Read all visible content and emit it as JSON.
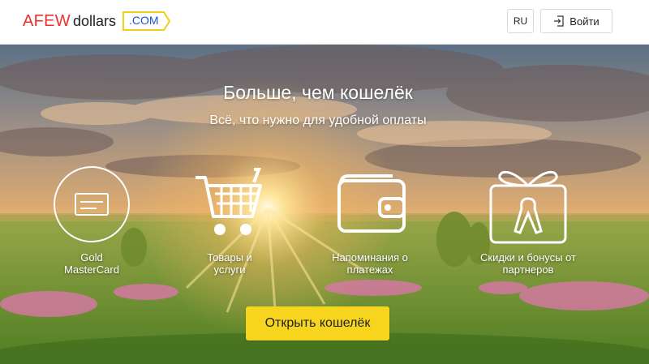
{
  "header": {
    "logo": {
      "part1": "AFEW",
      "part2": "dollars",
      "part3": ".COM"
    },
    "lang_label": "RU",
    "login_label": "Войти"
  },
  "hero": {
    "title": "Больше, чем кошелёк",
    "subtitle": "Всё, что нужно для удобной оплаты",
    "features": [
      {
        "icon": "credit-card-icon",
        "line1": "Gold",
        "line2": "MasterCard"
      },
      {
        "icon": "shopping-cart-icon",
        "line1": "Товары и",
        "line2": "услуги"
      },
      {
        "icon": "wallet-icon",
        "line1": "Напоминания о",
        "line2": "платежах"
      },
      {
        "icon": "gift-icon",
        "line1": "Скидки и бонусы от",
        "line2": "партнеров"
      }
    ],
    "cta_label": "Открыть кошелёк"
  },
  "colors": {
    "brand_red": "#e8322c",
    "brand_blue": "#1a56c8",
    "brand_yellow": "#f7d51f"
  }
}
